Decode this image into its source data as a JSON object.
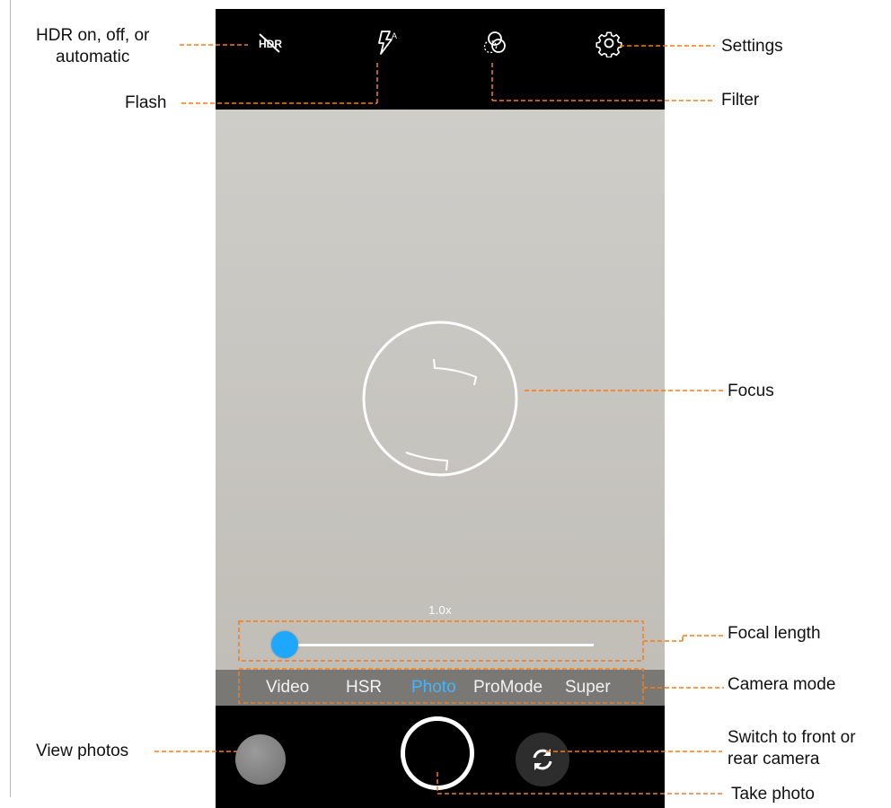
{
  "camera": {
    "top_icons": [
      {
        "name": "hdr-icon",
        "label": "HDR"
      },
      {
        "name": "flash-auto-icon",
        "label": "A"
      },
      {
        "name": "filter-icon"
      },
      {
        "name": "gear-icon"
      }
    ],
    "zoom": {
      "label": "1.0x",
      "level": 0.0
    },
    "modes": [
      {
        "label": "Video",
        "active": false
      },
      {
        "label": "HSR",
        "active": false
      },
      {
        "label": "Photo",
        "active": true
      },
      {
        "label": "ProMode",
        "active": false
      },
      {
        "label": "Super",
        "active": false
      }
    ]
  },
  "annotations": {
    "hdr": "HDR on, off, or\nautomatic",
    "flash": "Flash",
    "settings": "Settings",
    "filter": "Filter",
    "focus": "Focus",
    "focal_length": "Focal length",
    "camera_mode": "Camera mode",
    "view_photos": "View photos",
    "switch_camera": "Switch to front or\nrear camera",
    "take_photo": "Take photo"
  },
  "colors": {
    "callout": "#ef7d22",
    "accent": "#1ea7ff",
    "active_mode": "#3fb6ff"
  }
}
